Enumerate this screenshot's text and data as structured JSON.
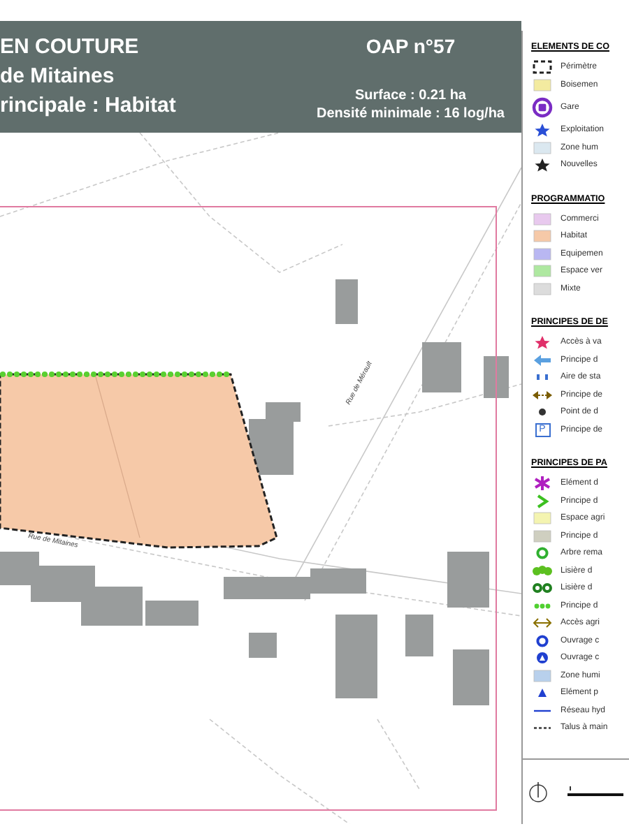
{
  "header": {
    "title_lines": [
      "EN COUTURE",
      "de Mitaines",
      "rincipale : Habitat"
    ],
    "oap": "OAP n°57",
    "surface": "Surface : 0.21 ha",
    "density": "Densité minimale : 16 log/ha"
  },
  "map": {
    "street_labels": [
      {
        "text": "Rue de Mitaines",
        "kind": "horizontal"
      },
      {
        "text": "Rue de Mérault",
        "kind": "diagonal"
      }
    ]
  },
  "legend": {
    "sections": [
      {
        "title": "ELEMENTS DE CO",
        "items": [
          {
            "label": "Périmètre",
            "kind": "dashed-rect",
            "color": "#222222"
          },
          {
            "label": "Boisemen",
            "kind": "swatch",
            "color": "#f3eba0"
          },
          {
            "label": "Gare",
            "kind": "badge",
            "color": "#7a2cc4"
          },
          {
            "label": "Exploitation",
            "kind": "star",
            "color": "#2a4fd6"
          },
          {
            "label": "Zone hum",
            "kind": "swatch",
            "color": "#dbe8f0"
          },
          {
            "label": "Nouvelles",
            "kind": "star",
            "color": "#222222"
          }
        ]
      },
      {
        "title": "PROGRAMMATIO",
        "items": [
          {
            "label": "Commerci",
            "kind": "swatch",
            "color": "#e8c9ee"
          },
          {
            "label": "Habitat",
            "kind": "swatch",
            "color": "#f6c9a8"
          },
          {
            "label": "Equipemen",
            "kind": "swatch",
            "color": "#b9b7f2"
          },
          {
            "label": "Espace ver",
            "kind": "swatch",
            "color": "#aee8a0"
          },
          {
            "label": "Mixte",
            "kind": "swatch",
            "color": "#dcdcdc"
          }
        ]
      },
      {
        "title": "PRINCIPES DE DE",
        "items": [
          {
            "label": "Accès à va",
            "kind": "star",
            "color": "#e0306a"
          },
          {
            "label": "Principe d",
            "kind": "arrow",
            "color": "#5aa0e0"
          },
          {
            "label": "Aire de sta",
            "kind": "dashes",
            "color": "#3a6fd0"
          },
          {
            "label": "Principe de",
            "kind": "dashed-arrow",
            "color": "#7a5c00"
          },
          {
            "label": "Point de d",
            "kind": "dot",
            "color": "#333333"
          },
          {
            "label": "Principe de",
            "kind": "parking",
            "color": "#3a6fd0",
            "glyph": "P"
          }
        ]
      },
      {
        "title": "PRINCIPES DE PA",
        "items": [
          {
            "label": "Elément d",
            "kind": "asterisk",
            "color": "#b020c0"
          },
          {
            "label": "Principe d",
            "kind": "chevron",
            "color": "#3cc020"
          },
          {
            "label": "Espace agri",
            "kind": "swatch",
            "color": "#f4f4b0"
          },
          {
            "label": "Principe d",
            "kind": "swatch",
            "color": "#cfcfc0"
          },
          {
            "label": "Arbre rema",
            "kind": "ring",
            "color": "#30b030"
          },
          {
            "label": "Lisière d",
            "kind": "tree-row",
            "color": "#5cc020"
          },
          {
            "label": "Lisière d",
            "kind": "double-ring",
            "color": "#208020"
          },
          {
            "label": "Principe d",
            "kind": "dots",
            "color": "#50d030"
          },
          {
            "label": "Accès agri",
            "kind": "double-arrow",
            "color": "#8a7000"
          },
          {
            "label": "Ouvrage c",
            "kind": "ring",
            "color": "#2040d0"
          },
          {
            "label": "Ouvrage c",
            "kind": "triangle-ring",
            "color": "#2040d0"
          },
          {
            "label": "Zone humi",
            "kind": "swatch",
            "color": "#b8d0ec"
          },
          {
            "label": "Elément p",
            "kind": "triangle",
            "color": "#2040d0"
          },
          {
            "label": "Réseau hyd",
            "kind": "line",
            "color": "#2040d0"
          },
          {
            "label": "Talus à main",
            "kind": "dotted-line",
            "color": "#555555"
          }
        ]
      }
    ]
  }
}
